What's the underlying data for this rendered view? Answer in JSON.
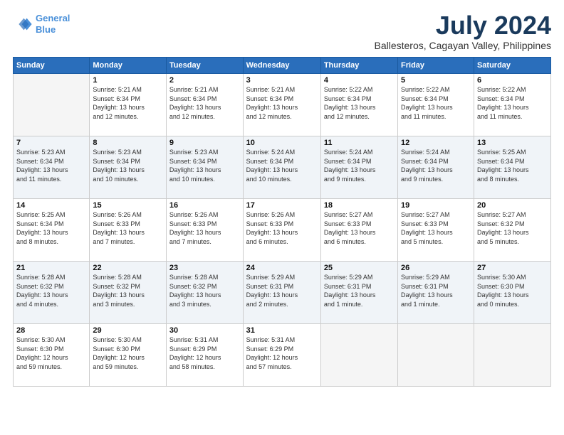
{
  "logo": {
    "line1": "General",
    "line2": "Blue"
  },
  "title": "July 2024",
  "subtitle": "Ballesteros, Cagayan Valley, Philippines",
  "days_header": [
    "Sunday",
    "Monday",
    "Tuesday",
    "Wednesday",
    "Thursday",
    "Friday",
    "Saturday"
  ],
  "weeks": [
    [
      {
        "day": "",
        "info": ""
      },
      {
        "day": "1",
        "info": "Sunrise: 5:21 AM\nSunset: 6:34 PM\nDaylight: 13 hours\nand 12 minutes."
      },
      {
        "day": "2",
        "info": "Sunrise: 5:21 AM\nSunset: 6:34 PM\nDaylight: 13 hours\nand 12 minutes."
      },
      {
        "day": "3",
        "info": "Sunrise: 5:21 AM\nSunset: 6:34 PM\nDaylight: 13 hours\nand 12 minutes."
      },
      {
        "day": "4",
        "info": "Sunrise: 5:22 AM\nSunset: 6:34 PM\nDaylight: 13 hours\nand 12 minutes."
      },
      {
        "day": "5",
        "info": "Sunrise: 5:22 AM\nSunset: 6:34 PM\nDaylight: 13 hours\nand 11 minutes."
      },
      {
        "day": "6",
        "info": "Sunrise: 5:22 AM\nSunset: 6:34 PM\nDaylight: 13 hours\nand 11 minutes."
      }
    ],
    [
      {
        "day": "7",
        "info": "Sunrise: 5:23 AM\nSunset: 6:34 PM\nDaylight: 13 hours\nand 11 minutes."
      },
      {
        "day": "8",
        "info": "Sunrise: 5:23 AM\nSunset: 6:34 PM\nDaylight: 13 hours\nand 10 minutes."
      },
      {
        "day": "9",
        "info": "Sunrise: 5:23 AM\nSunset: 6:34 PM\nDaylight: 13 hours\nand 10 minutes."
      },
      {
        "day": "10",
        "info": "Sunrise: 5:24 AM\nSunset: 6:34 PM\nDaylight: 13 hours\nand 10 minutes."
      },
      {
        "day": "11",
        "info": "Sunrise: 5:24 AM\nSunset: 6:34 PM\nDaylight: 13 hours\nand 9 minutes."
      },
      {
        "day": "12",
        "info": "Sunrise: 5:24 AM\nSunset: 6:34 PM\nDaylight: 13 hours\nand 9 minutes."
      },
      {
        "day": "13",
        "info": "Sunrise: 5:25 AM\nSunset: 6:34 PM\nDaylight: 13 hours\nand 8 minutes."
      }
    ],
    [
      {
        "day": "14",
        "info": "Sunrise: 5:25 AM\nSunset: 6:34 PM\nDaylight: 13 hours\nand 8 minutes."
      },
      {
        "day": "15",
        "info": "Sunrise: 5:26 AM\nSunset: 6:33 PM\nDaylight: 13 hours\nand 7 minutes."
      },
      {
        "day": "16",
        "info": "Sunrise: 5:26 AM\nSunset: 6:33 PM\nDaylight: 13 hours\nand 7 minutes."
      },
      {
        "day": "17",
        "info": "Sunrise: 5:26 AM\nSunset: 6:33 PM\nDaylight: 13 hours\nand 6 minutes."
      },
      {
        "day": "18",
        "info": "Sunrise: 5:27 AM\nSunset: 6:33 PM\nDaylight: 13 hours\nand 6 minutes."
      },
      {
        "day": "19",
        "info": "Sunrise: 5:27 AM\nSunset: 6:33 PM\nDaylight: 13 hours\nand 5 minutes."
      },
      {
        "day": "20",
        "info": "Sunrise: 5:27 AM\nSunset: 6:32 PM\nDaylight: 13 hours\nand 5 minutes."
      }
    ],
    [
      {
        "day": "21",
        "info": "Sunrise: 5:28 AM\nSunset: 6:32 PM\nDaylight: 13 hours\nand 4 minutes."
      },
      {
        "day": "22",
        "info": "Sunrise: 5:28 AM\nSunset: 6:32 PM\nDaylight: 13 hours\nand 3 minutes."
      },
      {
        "day": "23",
        "info": "Sunrise: 5:28 AM\nSunset: 6:32 PM\nDaylight: 13 hours\nand 3 minutes."
      },
      {
        "day": "24",
        "info": "Sunrise: 5:29 AM\nSunset: 6:31 PM\nDaylight: 13 hours\nand 2 minutes."
      },
      {
        "day": "25",
        "info": "Sunrise: 5:29 AM\nSunset: 6:31 PM\nDaylight: 13 hours\nand 1 minute."
      },
      {
        "day": "26",
        "info": "Sunrise: 5:29 AM\nSunset: 6:31 PM\nDaylight: 13 hours\nand 1 minute."
      },
      {
        "day": "27",
        "info": "Sunrise: 5:30 AM\nSunset: 6:30 PM\nDaylight: 13 hours\nand 0 minutes."
      }
    ],
    [
      {
        "day": "28",
        "info": "Sunrise: 5:30 AM\nSunset: 6:30 PM\nDaylight: 12 hours\nand 59 minutes."
      },
      {
        "day": "29",
        "info": "Sunrise: 5:30 AM\nSunset: 6:30 PM\nDaylight: 12 hours\nand 59 minutes."
      },
      {
        "day": "30",
        "info": "Sunrise: 5:31 AM\nSunset: 6:29 PM\nDaylight: 12 hours\nand 58 minutes."
      },
      {
        "day": "31",
        "info": "Sunrise: 5:31 AM\nSunset: 6:29 PM\nDaylight: 12 hours\nand 57 minutes."
      },
      {
        "day": "",
        "info": ""
      },
      {
        "day": "",
        "info": ""
      },
      {
        "day": "",
        "info": ""
      }
    ]
  ]
}
